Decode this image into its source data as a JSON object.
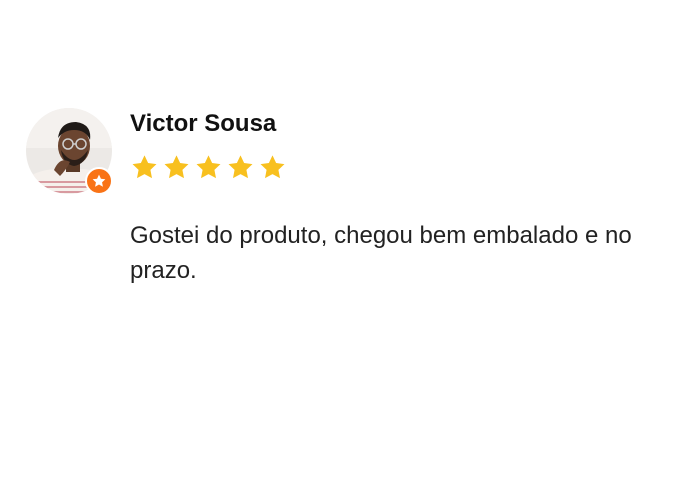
{
  "review": {
    "name": "Victor Sousa",
    "rating": 5,
    "rating_max": 5,
    "text": "Gostei do produto, chegou bem embalado e no prazo."
  },
  "icons": {
    "star": "star-icon",
    "badge": "star-badge-icon",
    "avatar": "user-photo"
  },
  "colors": {
    "star": "#f8c01f",
    "badge": "#f97316",
    "name": "#111111",
    "text": "#222222"
  }
}
